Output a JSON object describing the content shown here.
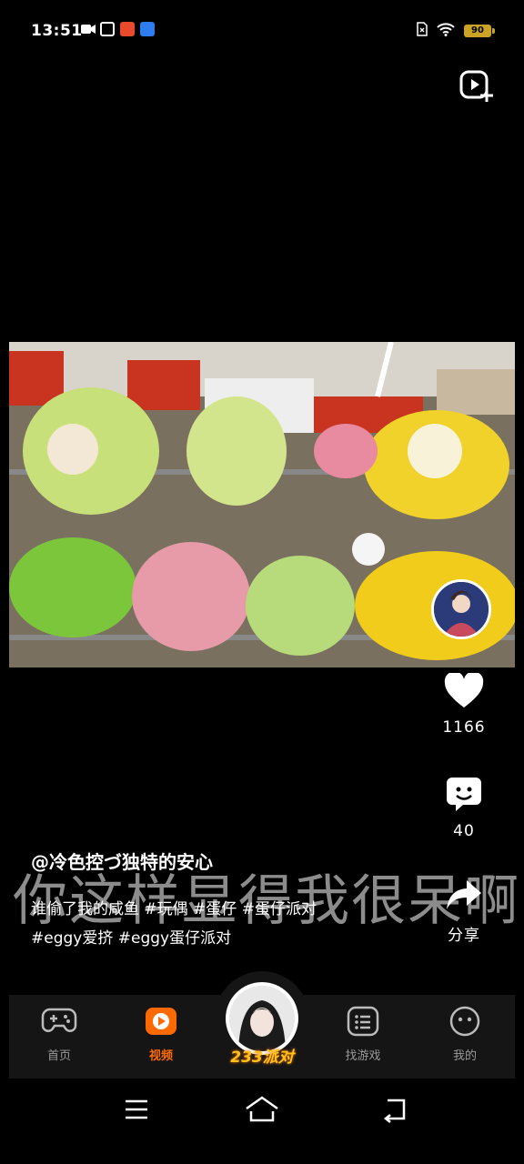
{
  "status_bar": {
    "time": "13:51",
    "battery": "90",
    "icons_left": [
      "video-record-icon",
      "app-icon-1",
      "app-icon-2",
      "paw-app-icon"
    ],
    "icons_right": [
      "sim-icon",
      "wifi-icon",
      "battery-icon"
    ]
  },
  "top_action": {
    "icon": "add-video-icon"
  },
  "video": {
    "description": "plush toys on store shelf",
    "overlay_text": "你这样显得我很呆啊"
  },
  "side_actions": {
    "like_count": "1166",
    "comment_count": "40",
    "share_label": "分享"
  },
  "post": {
    "author": "@冷色控づ独特的安心",
    "line1": "谁偷了我的咸鱼 #玩偶 #蛋仔 #蛋仔派对",
    "line2": "#eggy爱挤 #eggy蛋仔派对"
  },
  "bottom_nav": {
    "items": [
      {
        "label": "首页",
        "icon": "gamepad-icon"
      },
      {
        "label": "视频",
        "icon": "video-play-icon"
      },
      {
        "label": "找游戏",
        "icon": "list-icon"
      },
      {
        "label": "我的",
        "icon": "profile-face-icon"
      }
    ],
    "center_label": "233派对"
  },
  "colors": {
    "accent": "#ff6a00",
    "background": "#000000",
    "nav_bg": "#151515",
    "battery": "#c9a227",
    "center_label": "#ffc21a"
  }
}
